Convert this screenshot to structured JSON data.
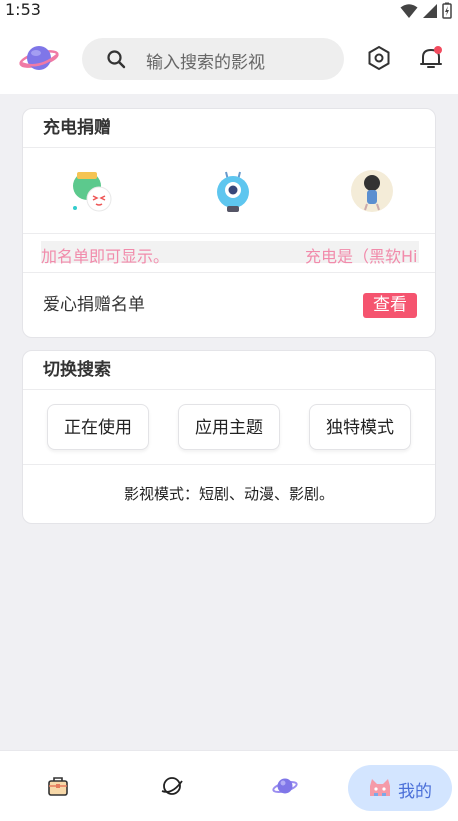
{
  "status": {
    "time": "1:53"
  },
  "header": {
    "logo": "planet-logo-icon",
    "search_placeholder": "输入搜索的影视",
    "settings_icon": "hexagon-settings-icon",
    "notification_icon": "bell-icon"
  },
  "donation": {
    "title": "充电捐赠",
    "donors": [
      "donor-avatar-1",
      "donor-avatar-2",
      "donor-avatar-3"
    ],
    "marquee_left": "加名单即可显示。",
    "marquee_right": "充电是（黑软Hi",
    "list_label": "爱心捐赠名单",
    "view_button": "查看"
  },
  "search_switch": {
    "title": "切换搜索",
    "buttons": [
      "正在使用",
      "应用主题",
      "独特模式"
    ],
    "description": "影视模式：短剧、动漫、影剧。"
  },
  "bottom_nav": {
    "items": [
      "home-box-icon",
      "planet-outline-icon",
      "planet-purple-icon"
    ],
    "active_label": "我的",
    "active_icon": "cat-icon"
  },
  "colors": {
    "accent_pink": "#f5546f",
    "marquee_pink": "#f18bab",
    "nav_active_bg": "#d3e5ff",
    "nav_active_text": "#4a6fd8"
  }
}
